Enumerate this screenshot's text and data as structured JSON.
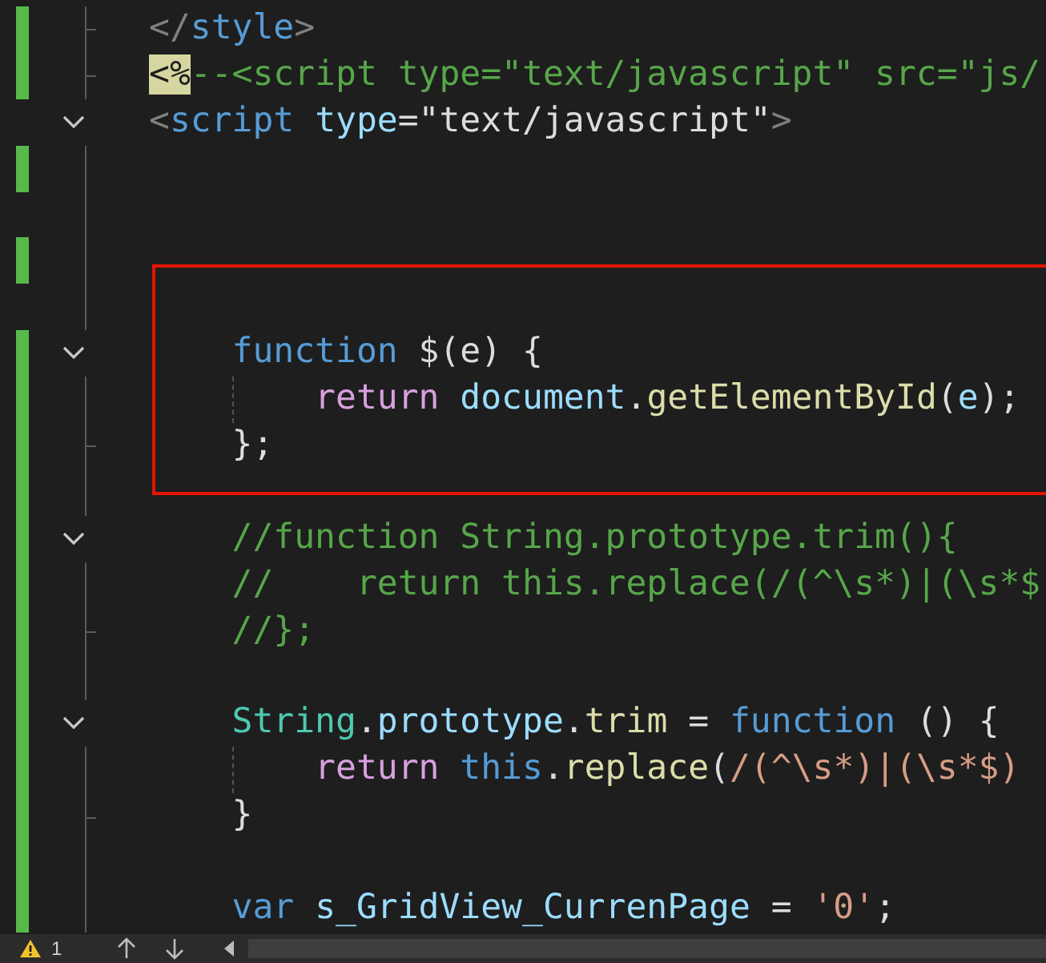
{
  "editor": {
    "lines": [
      {
        "changed": true,
        "kind": "fold_end",
        "boxed": false,
        "guide": false,
        "tokens": [
          {
            "kind": "punct",
            "text": "</"
          },
          {
            "kind": "tag",
            "text": "style"
          },
          {
            "kind": "punct",
            "text": ">"
          }
        ]
      },
      {
        "changed": true,
        "kind": "fold_end",
        "boxed": false,
        "guide": false,
        "tokens": [
          {
            "kind": "match",
            "text": "<%"
          },
          {
            "kind": "comment",
            "text": "--<script type=\"text/javascript\" src=\"js/"
          }
        ]
      },
      {
        "changed": false,
        "kind": "fold_start",
        "boxed": false,
        "guide": false,
        "tokens": [
          {
            "kind": "punct",
            "text": "<"
          },
          {
            "kind": "tag",
            "text": "script "
          },
          {
            "kind": "attr",
            "text": "type"
          },
          {
            "kind": "plain",
            "text": "=\"text/javascript\""
          },
          {
            "kind": "punct",
            "text": ">"
          }
        ]
      },
      {
        "changed": true,
        "kind": "fold_line",
        "boxed": false,
        "guide": false
      },
      {
        "changed": false,
        "kind": "fold_line",
        "boxed": false,
        "guide": false
      },
      {
        "changed": true,
        "kind": "fold_line",
        "boxed": false,
        "guide": false
      },
      {
        "changed": false,
        "kind": "fold_line",
        "boxed": true,
        "guide": false
      },
      {
        "changed": true,
        "kind": "fold_start",
        "boxed": true,
        "guide": false,
        "tokens": [
          {
            "kind": "keyword",
            "text": "    function"
          },
          {
            "kind": "plain",
            "text": " $(e) {"
          }
        ]
      },
      {
        "changed": true,
        "kind": "fold_line",
        "boxed": true,
        "guide": true,
        "tokens": [
          {
            "kind": "control",
            "text": "        return "
          },
          {
            "kind": "var",
            "text": "document"
          },
          {
            "kind": "plain",
            "text": "."
          },
          {
            "kind": "func",
            "text": "getElementById"
          },
          {
            "kind": "plain",
            "text": "("
          },
          {
            "kind": "var",
            "text": "e"
          },
          {
            "kind": "plain",
            "text": ");"
          }
        ]
      },
      {
        "changed": true,
        "kind": "fold_end",
        "boxed": true,
        "guide": false,
        "tokens": [
          {
            "kind": "plain",
            "text": "    };"
          }
        ]
      },
      {
        "changed": true,
        "kind": "fold_line",
        "boxed": false,
        "guide": false
      },
      {
        "changed": true,
        "kind": "fold_start",
        "boxed": false,
        "guide": false,
        "tokens": [
          {
            "kind": "comment",
            "text": "    //function String.prototype.trim(){"
          }
        ]
      },
      {
        "changed": true,
        "kind": "fold_line",
        "boxed": false,
        "guide": false,
        "tokens": [
          {
            "kind": "comment",
            "text": "    //    return this.replace(/(^\\s*)|(\\s*$"
          }
        ]
      },
      {
        "changed": true,
        "kind": "fold_end",
        "boxed": false,
        "guide": false,
        "tokens": [
          {
            "kind": "comment",
            "text": "    //};"
          }
        ]
      },
      {
        "changed": true,
        "kind": "fold_line",
        "boxed": false,
        "guide": false
      },
      {
        "changed": true,
        "kind": "fold_start",
        "boxed": false,
        "guide": false,
        "tokens": [
          {
            "kind": "type",
            "text": "    String"
          },
          {
            "kind": "plain",
            "text": "."
          },
          {
            "kind": "var",
            "text": "prototype"
          },
          {
            "kind": "plain",
            "text": "."
          },
          {
            "kind": "func",
            "text": "trim"
          },
          {
            "kind": "plain",
            "text": " = "
          },
          {
            "kind": "keyword",
            "text": "function"
          },
          {
            "kind": "plain",
            "text": " () {"
          }
        ]
      },
      {
        "changed": true,
        "kind": "fold_line",
        "boxed": false,
        "guide": true,
        "tokens": [
          {
            "kind": "control",
            "text": "        return "
          },
          {
            "kind": "keyword",
            "text": "this"
          },
          {
            "kind": "plain",
            "text": "."
          },
          {
            "kind": "func",
            "text": "replace"
          },
          {
            "kind": "plain",
            "text": "("
          },
          {
            "kind": "regex",
            "text": "/(^\\s*)|(\\s*$)"
          }
        ]
      },
      {
        "changed": true,
        "kind": "fold_end",
        "boxed": false,
        "guide": false,
        "tokens": [
          {
            "kind": "plain",
            "text": "    }"
          }
        ]
      },
      {
        "changed": true,
        "kind": "fold_line",
        "boxed": false,
        "guide": false
      },
      {
        "changed": true,
        "kind": "fold_line",
        "boxed": false,
        "guide": false,
        "tokens": [
          {
            "kind": "keyword",
            "text": "    var "
          },
          {
            "kind": "var",
            "text": "s_GridView_CurrenPage"
          },
          {
            "kind": "plain",
            "text": " = "
          },
          {
            "kind": "regex",
            "text": "'0'"
          },
          {
            "kind": "plain",
            "text": ";"
          }
        ]
      }
    ]
  },
  "status_bar": {
    "warnings": "1"
  }
}
